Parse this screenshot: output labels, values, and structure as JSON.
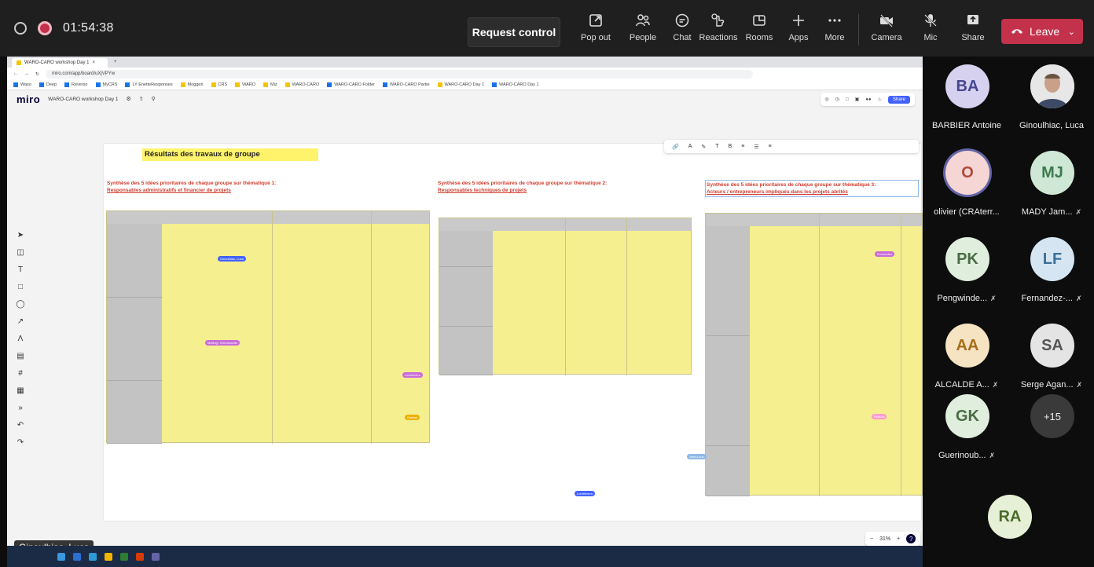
{
  "meeting": {
    "timer": "01:54:38",
    "request_control": "Request control",
    "toolbar": [
      {
        "label": "Pop out",
        "icon": "pop-out-icon"
      },
      {
        "label": "People",
        "icon": "people-icon"
      },
      {
        "label": "Chat",
        "icon": "chat-icon"
      },
      {
        "label": "Reactions",
        "icon": "reactions-icon"
      },
      {
        "label": "Rooms",
        "icon": "rooms-icon"
      },
      {
        "label": "Apps",
        "icon": "apps-icon"
      },
      {
        "label": "More",
        "icon": "more-icon"
      },
      {
        "label": "Camera",
        "icon": "camera-off-icon"
      },
      {
        "label": "Mic",
        "icon": "mic-off-icon"
      },
      {
        "label": "Share",
        "icon": "share-icon"
      }
    ],
    "leave": "Leave",
    "presenter": "Ginoulhiac, Luca"
  },
  "browser": {
    "tab_title": "WARO-CARO workshop Day 1",
    "url": "miro.com/app/board/uXjVPYw",
    "bookmarks": [
      "Waso",
      "Deep",
      "Reverso",
      "MyCRS",
      "LY EnetteResponses",
      "Moggeri",
      "CRS",
      "WARO",
      "Miz",
      "WARO-CARO",
      "WARO-CARO Folder",
      "WARO-CARO Partie",
      "WARO-CARO Day 1",
      "WARO-CARO Day 1"
    ]
  },
  "miro": {
    "logo": "miro",
    "board_title": "WARO-CARO workshop Day 1",
    "share": "Share",
    "zoom": "31%",
    "help": "?",
    "frame_title": "Résultats des travaux de groupe",
    "sections": [
      {
        "heading_line1": "Synthèse des 5 idées prioritaires de chaque groupe sur thématique 1:",
        "heading_line2": "Responsables administratifs et financier de projets"
      },
      {
        "heading_line1": "Synthèse des 5 idées prioritaires de chaque groupe sur thématique 2:",
        "heading_line2": "Responsables techniques de projets"
      },
      {
        "heading_line1": "Synthèse des 5 idées prioritaires de chaque groupe sur thématique 3:",
        "heading_line2": "Acteurs / entrepreneurs impliqués dans les projets abrités"
      }
    ],
    "cursors": [
      {
        "label": "Ginoulhiac, Luca",
        "color": "#4262ff"
      },
      {
        "label": "Melting / Emmanuelle",
        "color": "#c86bd8"
      },
      {
        "label": "Lomthivera",
        "color": "#c86bd8"
      },
      {
        "label": "Gaetan",
        "color": "#ebb000"
      },
      {
        "label": "Jean-Lous",
        "color": "#8fb8e8"
      },
      {
        "label": "Lomthivera",
        "color": "#4262ff"
      },
      {
        "label": "Patricia",
        "color": "#ff9ad0"
      },
      {
        "label": "Fernandez",
        "color": "#c86bd8"
      }
    ]
  },
  "participants": [
    {
      "initials": "BA",
      "name": "BARBIER Antoine",
      "muted": false,
      "bg": "#d6d1ee",
      "fg": "#444791"
    },
    {
      "initials": "",
      "name": "Ginoulhiac, Luca",
      "muted": false,
      "bg": "#e8e8e8",
      "fg": "#333"
    },
    {
      "initials": "O",
      "name": "olivier (CRAterr...",
      "muted": false,
      "bg": "#f6d6d4",
      "fg": "#b24a3a"
    },
    {
      "initials": "MJ",
      "name": "MADY Jam...",
      "muted": true,
      "bg": "#cfe8d6",
      "fg": "#3d7a4e"
    },
    {
      "initials": "PK",
      "name": "Pengwinde...",
      "muted": true,
      "bg": "#dfeedd",
      "fg": "#4a6b45"
    },
    {
      "initials": "LF",
      "name": "Fernandez-...",
      "muted": true,
      "bg": "#d5e6f2",
      "fg": "#3c6f96"
    },
    {
      "initials": "AA",
      "name": "ALCALDE A...",
      "muted": true,
      "bg": "#f6e3c2",
      "fg": "#a56c1a"
    },
    {
      "initials": "SA",
      "name": "Serge Agan...",
      "muted": true,
      "bg": "#e4e4e4",
      "fg": "#555"
    },
    {
      "initials": "GK",
      "name": "Guerinoub...",
      "muted": true,
      "bg": "#dfeedd",
      "fg": "#4a6b45"
    },
    {
      "initials": "+15",
      "name": "",
      "muted": false,
      "bg": "#3a3a3a",
      "fg": "#eee"
    }
  ],
  "speaker_tile": {
    "initials": "RA",
    "bg": "#e6f0d6",
    "fg": "#4a6b2a"
  }
}
